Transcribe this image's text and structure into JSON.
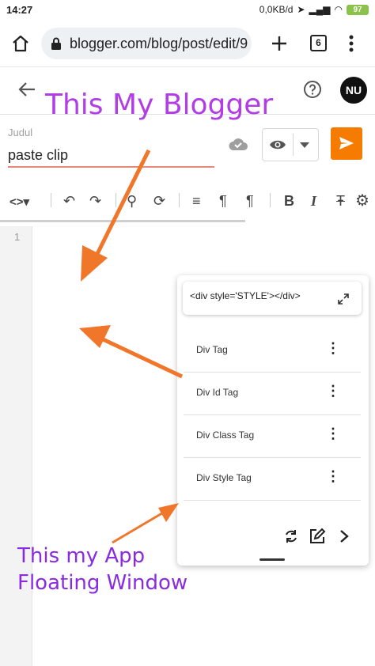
{
  "status_bar": {
    "time": "14:27",
    "network_speed": "0,0KB/d",
    "battery": "97"
  },
  "browser": {
    "url": "blogger.com/blog/post/edit/9",
    "tab_count": "6"
  },
  "editor": {
    "avatar_initials": "NU",
    "title_label": "Judul",
    "title_value": "paste clip",
    "line_number": "1",
    "send_color": "#f57c00"
  },
  "overlay": {
    "blogger_caption": "This My Blogger",
    "app_caption_line1": "This my App",
    "app_caption_line2": "Floating Window",
    "arrow_color": "#f0762a"
  },
  "floating_window": {
    "preview_text": "<div style='STYLE'></div>",
    "items": [
      {
        "label": "Div Tag"
      },
      {
        "label": "Div Id Tag"
      },
      {
        "label": "Div Class Tag"
      },
      {
        "label": "Div Style Tag"
      }
    ]
  }
}
